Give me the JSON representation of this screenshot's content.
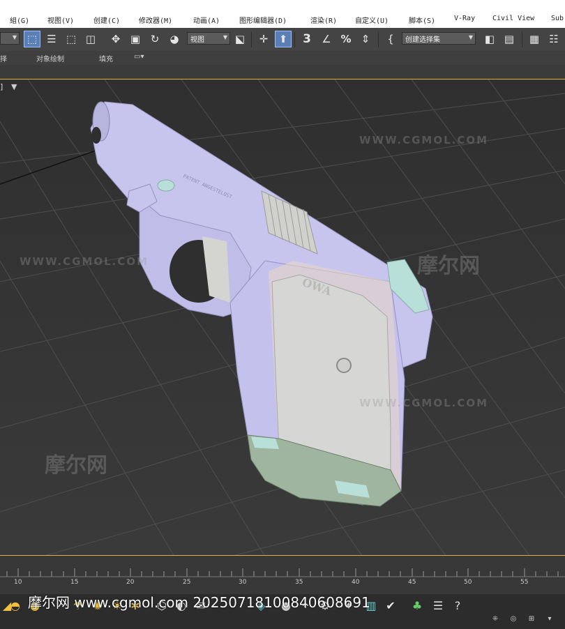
{
  "menu": {
    "items": [
      "組(G)",
      "视图(V)",
      "创建(C)",
      "修改器(M)",
      "动画(A)",
      "图形编辑器(D)",
      "渲染(R)",
      "自定义(U)",
      "脚本(S)",
      "V-Ray",
      "Civil View",
      "Sub"
    ]
  },
  "toolbar": {
    "view_dropdown": "视图",
    "selection_set_dropdown": "创建选择集",
    "snap_label": "3"
  },
  "ribbon": {
    "left_partial": "择",
    "object_paint": "对象绘制",
    "fill": "填充"
  },
  "viewport": {
    "label": "]",
    "model_text_1": "PATENT ANGESTELOST",
    "model_text_2": "OWA",
    "watermarks": {
      "url": "WWW.CGMOL.COM",
      "logo": "摩尔网"
    }
  },
  "timeline": {
    "ticks": [
      "10",
      "15",
      "20",
      "25",
      "30",
      "35",
      "40",
      "45",
      "50",
      "55"
    ]
  },
  "overlay": {
    "text": "摩尔网 www.cgmol.com 2025071810084060869​1"
  },
  "colors": {
    "model_body": "#c7c5ee",
    "grip": "#d6d6d4",
    "accent_frame": "#d8b14a",
    "active_tool": "#5a7fb5"
  }
}
